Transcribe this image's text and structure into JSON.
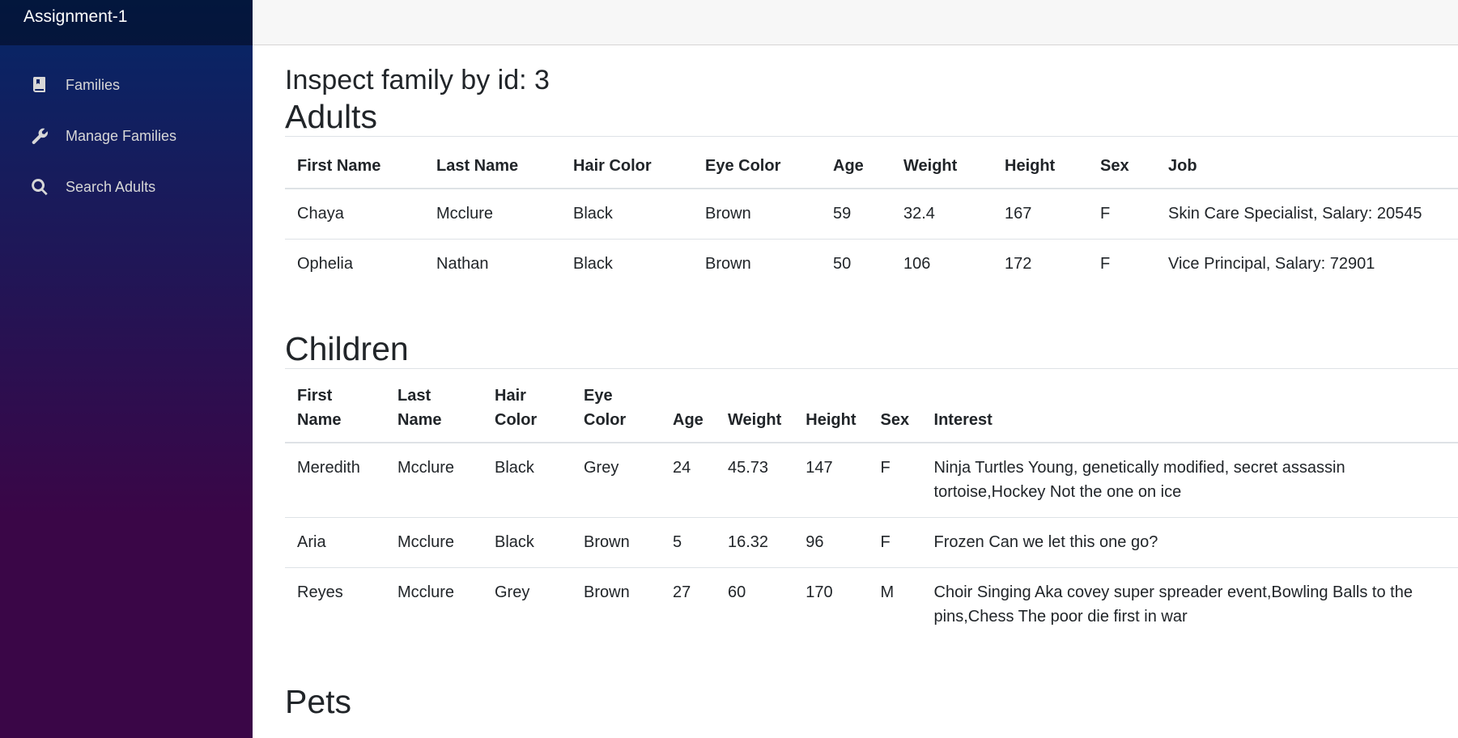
{
  "app": {
    "title": "Assignment-1"
  },
  "sidebar": {
    "items": [
      {
        "label": "Families",
        "icon": "book-icon"
      },
      {
        "label": "Manage Families",
        "icon": "wrench-icon"
      },
      {
        "label": "Search Adults",
        "icon": "search-icon"
      }
    ]
  },
  "colors": {
    "sidebar_gradient_top": "#052767",
    "sidebar_gradient_bottom": "#3a0647",
    "top_row": "#f7f7f7",
    "text": "#212529"
  },
  "page": {
    "title": "Inspect family by id: 3",
    "adults_heading": "Adults",
    "children_heading": "Children",
    "pets_heading": "Pets"
  },
  "adults": {
    "headers": [
      "First Name",
      "Last Name",
      "Hair Color",
      "Eye Color",
      "Age",
      "Weight",
      "Height",
      "Sex",
      "Job"
    ],
    "rows": [
      [
        "Chaya",
        "Mcclure",
        "Black",
        "Brown",
        "59",
        "32.4",
        "167",
        "F",
        "Skin Care Specialist, Salary: 20545"
      ],
      [
        "Ophelia",
        "Nathan",
        "Black",
        "Brown",
        "50",
        "106",
        "172",
        "F",
        "Vice Principal, Salary: 72901"
      ]
    ]
  },
  "children": {
    "headers": [
      "First Name",
      "Last Name",
      "Hair Color",
      "Eye Color",
      "Age",
      "Weight",
      "Height",
      "Sex",
      "Interest"
    ],
    "rows": [
      [
        "Meredith",
        "Mcclure",
        "Black",
        "Grey",
        "24",
        "45.73",
        "147",
        "F",
        "Ninja Turtles Young, genetically modified, secret assassin tortoise,Hockey Not the one on ice"
      ],
      [
        "Aria",
        "Mcclure",
        "Black",
        "Brown",
        "5",
        "16.32",
        "96",
        "F",
        "Frozen Can we let this one go?"
      ],
      [
        "Reyes",
        "Mcclure",
        "Grey",
        "Brown",
        "27",
        "60",
        "170",
        "M",
        "Choir Singing Aka covey super spreader event,Bowling Balls to the pins,Chess The poor die first in war"
      ]
    ]
  }
}
